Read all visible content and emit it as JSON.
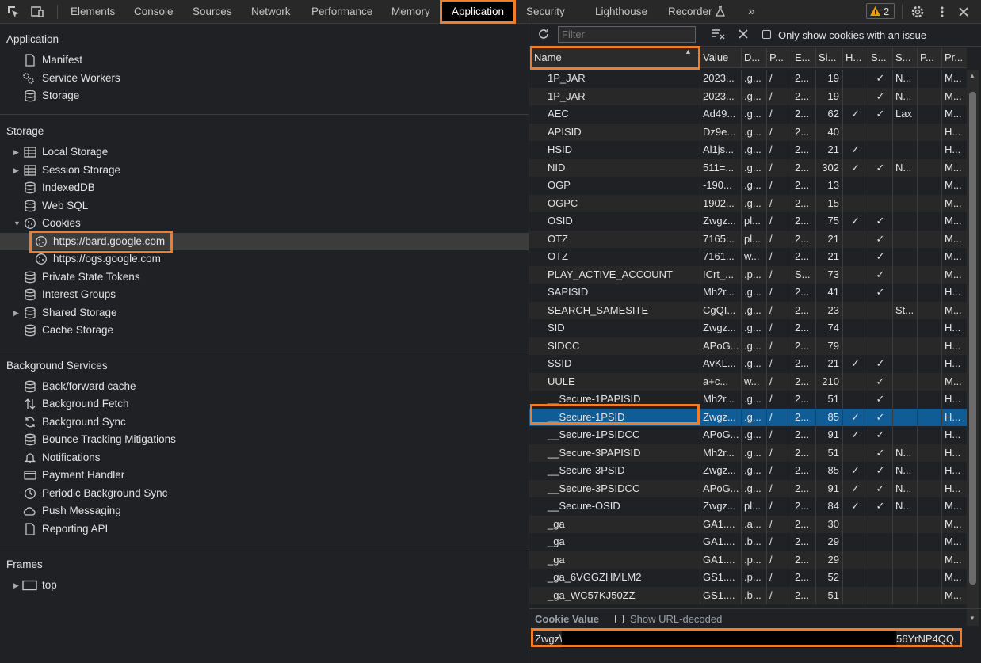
{
  "tabs": [
    "Elements",
    "Console",
    "Sources",
    "Network",
    "Performance",
    "Memory",
    "Application",
    "Security",
    "Lighthouse",
    "Recorder"
  ],
  "active_tab": "Application",
  "issues_count": "2",
  "sidebar": {
    "application": {
      "header": "Application",
      "items": [
        "Manifest",
        "Service Workers",
        "Storage"
      ]
    },
    "storage": {
      "header": "Storage",
      "items": [
        "Local Storage",
        "Session Storage",
        "IndexedDB",
        "Web SQL",
        "Cookies",
        "https://bard.google.com",
        "https://ogs.google.com",
        "Private State Tokens",
        "Interest Groups",
        "Shared Storage",
        "Cache Storage"
      ]
    },
    "background": {
      "header": "Background Services",
      "items": [
        "Back/forward cache",
        "Background Fetch",
        "Background Sync",
        "Bounce Tracking Mitigations",
        "Notifications",
        "Payment Handler",
        "Periodic Background Sync",
        "Push Messaging",
        "Reporting API"
      ]
    },
    "frames": {
      "header": "Frames",
      "items": [
        "top"
      ]
    }
  },
  "cookies_toolbar": {
    "filter_placeholder": "Filter",
    "only_issues_label": "Only show cookies with an issue"
  },
  "table": {
    "columns": [
      "Name",
      "Value",
      "D...",
      "P...",
      "E...",
      "Si...",
      "H...",
      "S...",
      "S...",
      "P...",
      "Pr..."
    ],
    "rows": [
      [
        "1P_JAR",
        "2023...",
        ".g...",
        "/",
        "2...",
        "19",
        "",
        "✓",
        "N...",
        "",
        "M..."
      ],
      [
        "1P_JAR",
        "2023...",
        ".g...",
        "/",
        "2...",
        "19",
        "",
        "✓",
        "N...",
        "",
        "M..."
      ],
      [
        "AEC",
        "Ad49...",
        ".g...",
        "/",
        "2...",
        "62",
        "✓",
        "✓",
        "Lax",
        "",
        "M..."
      ],
      [
        "APISID",
        "Dz9e...",
        ".g...",
        "/",
        "2...",
        "40",
        "",
        "",
        "",
        "",
        "H..."
      ],
      [
        "HSID",
        "Al1js...",
        ".g...",
        "/",
        "2...",
        "21",
        "✓",
        "",
        "",
        "",
        "H..."
      ],
      [
        "NID",
        "511=...",
        ".g...",
        "/",
        "2...",
        "302",
        "✓",
        "✓",
        "N...",
        "",
        "M..."
      ],
      [
        "OGP",
        "-190...",
        ".g...",
        "/",
        "2...",
        "13",
        "",
        "",
        "",
        "",
        "M..."
      ],
      [
        "OGPC",
        "1902...",
        ".g...",
        "/",
        "2...",
        "15",
        "",
        "",
        "",
        "",
        "M..."
      ],
      [
        "OSID",
        "Zwgz...",
        "pl...",
        "/",
        "2...",
        "75",
        "✓",
        "✓",
        "",
        "",
        "M..."
      ],
      [
        "OTZ",
        "7165...",
        "pl...",
        "/",
        "2...",
        "21",
        "",
        "✓",
        "",
        "",
        "M..."
      ],
      [
        "OTZ",
        "7161...",
        "w...",
        "/",
        "2...",
        "21",
        "",
        "✓",
        "",
        "",
        "M..."
      ],
      [
        "PLAY_ACTIVE_ACCOUNT",
        "ICrt_...",
        ".p...",
        "/",
        "S...",
        "73",
        "",
        "✓",
        "",
        "",
        "M..."
      ],
      [
        "SAPISID",
        "Mh2r...",
        ".g...",
        "/",
        "2...",
        "41",
        "",
        "✓",
        "",
        "",
        "H..."
      ],
      [
        "SEARCH_SAMESITE",
        "CgQI...",
        ".g...",
        "/",
        "2...",
        "23",
        "",
        "",
        "St...",
        "",
        "M..."
      ],
      [
        "SID",
        "Zwgz...",
        ".g...",
        "/",
        "2...",
        "74",
        "",
        "",
        "",
        "",
        "H..."
      ],
      [
        "SIDCC",
        "APoG...",
        ".g...",
        "/",
        "2...",
        "79",
        "",
        "",
        "",
        "",
        "H..."
      ],
      [
        "SSID",
        "AvKL...",
        ".g...",
        "/",
        "2...",
        "21",
        "✓",
        "✓",
        "",
        "",
        "H..."
      ],
      [
        "UULE",
        "a+c...",
        "w...",
        "/",
        "2...",
        "210",
        "",
        "✓",
        "",
        "",
        "M..."
      ],
      [
        "__Secure-1PAPISID",
        "Mh2r...",
        ".g...",
        "/",
        "2...",
        "51",
        "",
        "✓",
        "",
        "",
        "H..."
      ],
      [
        "__Secure-1PSID",
        "Zwgz...",
        ".g...",
        "/",
        "2...",
        "85",
        "✓",
        "✓",
        "",
        "",
        "H..."
      ],
      [
        "__Secure-1PSIDCC",
        "APoG...",
        ".g...",
        "/",
        "2...",
        "91",
        "✓",
        "✓",
        "",
        "",
        "H..."
      ],
      [
        "__Secure-3PAPISID",
        "Mh2r...",
        ".g...",
        "/",
        "2...",
        "51",
        "",
        "✓",
        "N...",
        "",
        "H..."
      ],
      [
        "__Secure-3PSID",
        "Zwgz...",
        ".g...",
        "/",
        "2...",
        "85",
        "✓",
        "✓",
        "N...",
        "",
        "H..."
      ],
      [
        "__Secure-3PSIDCC",
        "APoG...",
        ".g...",
        "/",
        "2...",
        "91",
        "✓",
        "✓",
        "N...",
        "",
        "H..."
      ],
      [
        "__Secure-OSID",
        "Zwgz...",
        "pl...",
        "/",
        "2...",
        "84",
        "✓",
        "✓",
        "N...",
        "",
        "M..."
      ],
      [
        "_ga",
        "GA1....",
        ".a...",
        "/",
        "2...",
        "30",
        "",
        "",
        "",
        "",
        "M..."
      ],
      [
        "_ga",
        "GA1....",
        ".b...",
        "/",
        "2...",
        "29",
        "",
        "",
        "",
        "",
        "M..."
      ],
      [
        "_ga",
        "GA1....",
        ".p...",
        "/",
        "2...",
        "29",
        "",
        "",
        "",
        "",
        "M..."
      ],
      [
        "_ga_6VGGZHMLM2",
        "GS1....",
        ".p...",
        "/",
        "2...",
        "52",
        "",
        "",
        "",
        "",
        "M..."
      ],
      [
        "_ga_WC57KJ50ZZ",
        "GS1....",
        ".b...",
        "/",
        "2...",
        "51",
        "",
        "",
        "",
        "",
        "M..."
      ]
    ]
  },
  "cookie_value": {
    "title": "Cookie Value",
    "show_decoded_label": "Show URL-decoded",
    "value_start": "Zwgz\\",
    "value_end": "56YrNP4QQ."
  }
}
